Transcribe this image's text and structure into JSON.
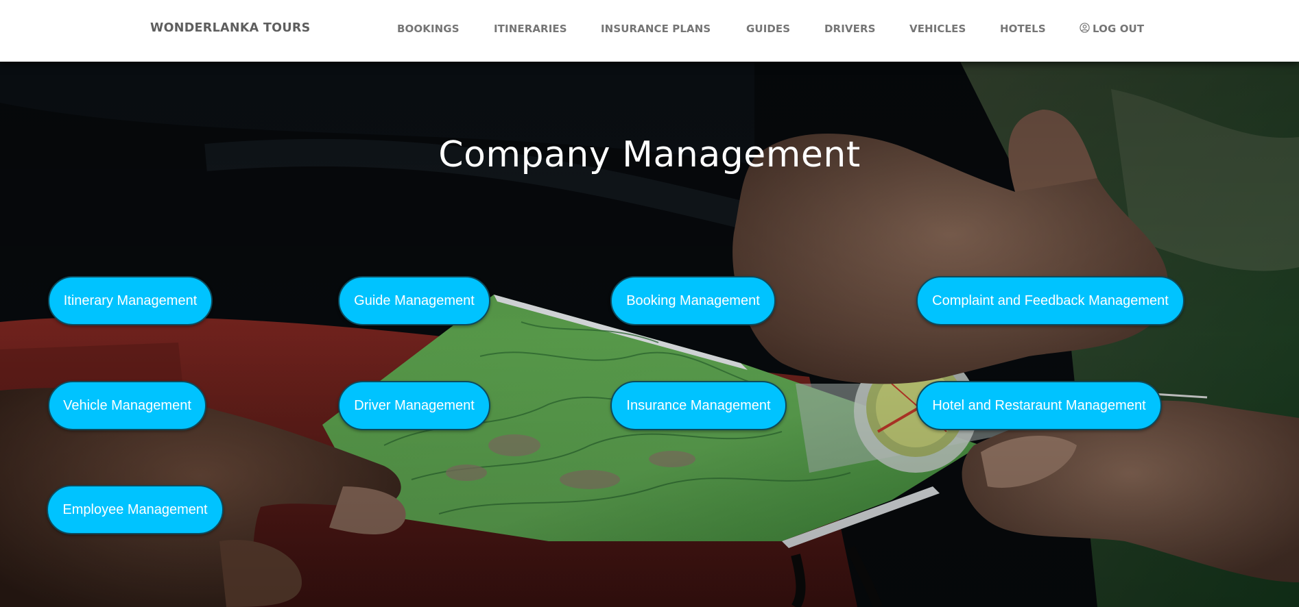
{
  "navbar": {
    "brand": "WONDERLANKA TOURS",
    "links": {
      "bookings": "BOOKINGS",
      "itineraries": "ITINERARIES",
      "insurance_plans": "INSURANCE PLANS",
      "guides": "GUIDES",
      "drivers": "DRIVERS",
      "vehicles": "VEHICLES",
      "hotels": "HOTELS",
      "logout": "LOG OUT"
    },
    "logout_icon": "user-circle-icon"
  },
  "hero": {
    "title": "Company Management",
    "background": "hands-holding-map-and-compass-photo"
  },
  "buttons": {
    "itinerary": "Itinerary Management",
    "guide": "Guide Management",
    "booking": "Booking Management",
    "complaint": "Complaint and Feedback Management",
    "vehicle": "Vehicle Management",
    "driver": "Driver Management",
    "insurance": "Insurance Management",
    "hotel": "Hotel and Restaraunt Management",
    "employee": "Employee Management"
  },
  "colors": {
    "button_bg": "#00c3ff",
    "button_border": "#0d4a5c",
    "nav_text": "#757575",
    "brand_text": "#5e5e5e",
    "title_text": "#ffffff"
  }
}
